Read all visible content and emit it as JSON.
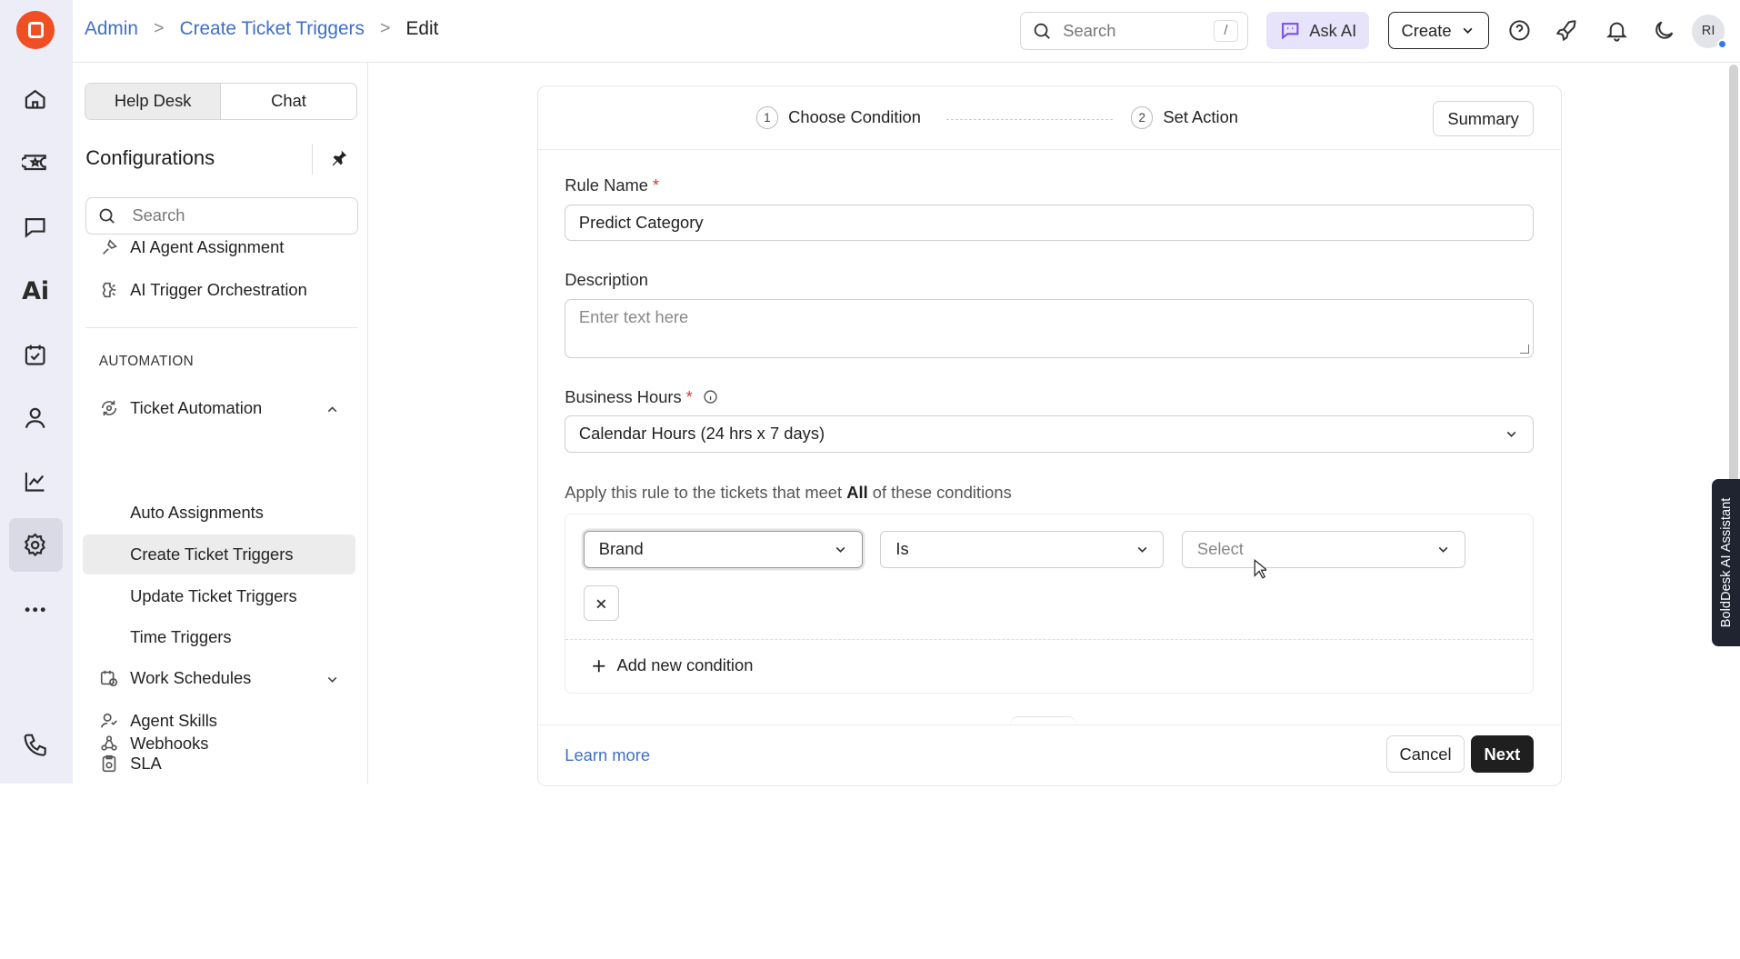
{
  "breadcrumb": {
    "root": "Admin",
    "parent": "Create Ticket Triggers",
    "current": "Edit",
    "separator": ">"
  },
  "topbar": {
    "search_placeholder": "Search",
    "search_shortcut": "/",
    "ask_ai_label": "Ask AI",
    "create_label": "Create",
    "avatar_initials": "RI"
  },
  "sidebar": {
    "tabs": [
      {
        "label": "Help Desk",
        "active": true
      },
      {
        "label": "Chat",
        "active": false
      }
    ],
    "title": "Configurations",
    "search_placeholder": "Search",
    "clipped_item": "AI Agent Assignment",
    "ai_trigger_item": "AI Trigger Orchestration",
    "automation_heading": "AUTOMATION",
    "ticket_automation": {
      "label": "Ticket Automation",
      "children": [
        "Auto Assignments",
        "Create Ticket Triggers",
        "Update Ticket Triggers",
        "Time Triggers"
      ],
      "active_child": "Create Ticket Triggers"
    },
    "work_schedules": "Work Schedules",
    "agent_skills": "Agent Skills",
    "sla": "SLA",
    "webhooks": "Webhooks"
  },
  "steps": [
    {
      "number": "1",
      "label": "Choose Condition"
    },
    {
      "number": "2",
      "label": "Set Action"
    }
  ],
  "summary_label": "Summary",
  "form": {
    "rule_name_label": "Rule Name",
    "rule_name_value": "Predict Category",
    "description_label": "Description",
    "description_placeholder": "Enter text here",
    "business_hours_label": "Business Hours",
    "business_hours_value": "Calendar Hours (24 hrs x 7 days)",
    "required_marker": "*"
  },
  "conditions": {
    "intro_prefix": "Apply this rule to the tickets that meet ",
    "intro_match": "All",
    "intro_suffix": " of these conditions",
    "rows": [
      {
        "field": "Brand",
        "operator": "Is",
        "value_placeholder": "Select"
      }
    ],
    "add_label": "Add new condition"
  },
  "footer": {
    "learn_more": "Learn more",
    "cancel": "Cancel",
    "next": "Next"
  },
  "assistant_tab": "BoldDesk AI Assistant",
  "colors": {
    "brand": "#f04e23",
    "link": "#3f6fc9",
    "primary_button": "#1f1f1f",
    "ask_ai_bg": "#e7e3fb"
  }
}
